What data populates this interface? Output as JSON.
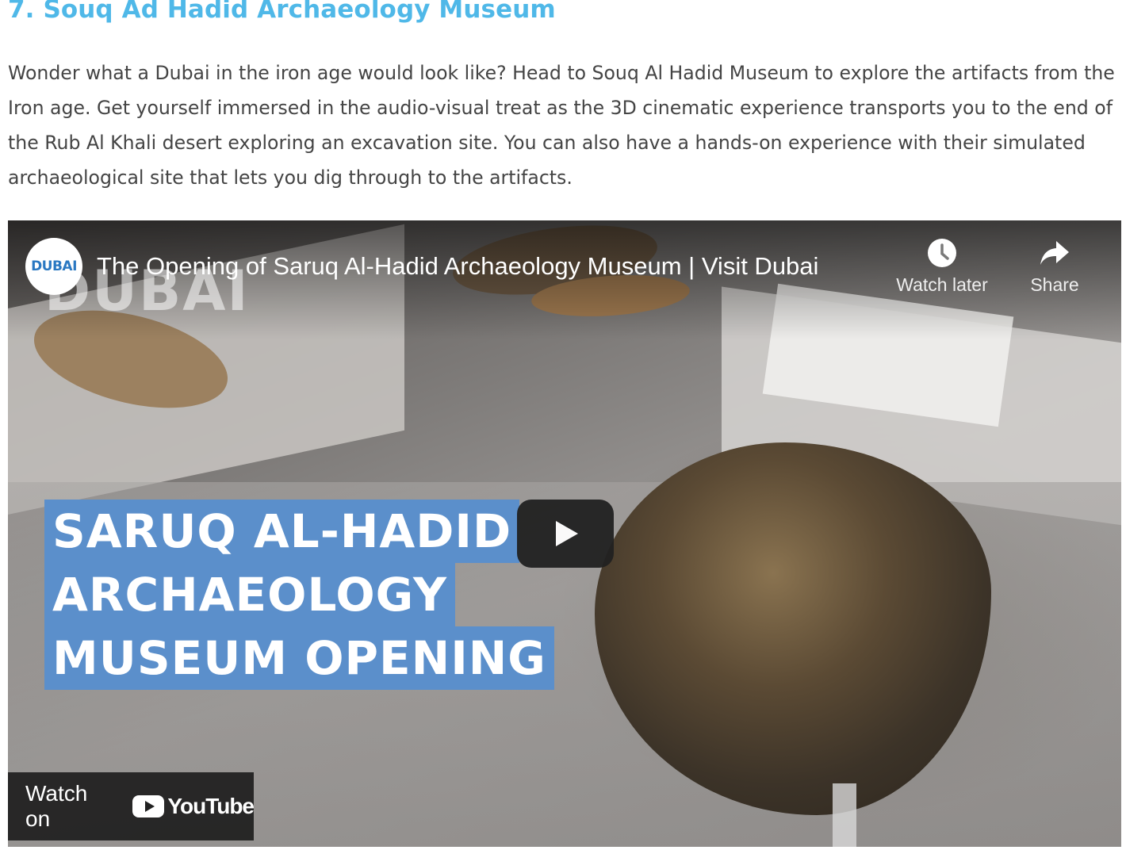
{
  "article": {
    "heading": "7. Souq Ad Hadid Archaeology Museum",
    "paragraph": "Wonder what a Dubai in the iron age would look like? Head to Souq Al Hadid Museum to explore the artifacts from the Iron age. Get yourself immersed in the audio-visual treat as the 3D cinematic experience transports you to the end of the Rub Al Khali desert exploring an excavation site. You can also have a hands-on experience with their simulated archaeological site that lets you dig through to the artifacts."
  },
  "video": {
    "channel_logo_text": "DUBAI",
    "title": "The Opening of Saruq Al-Hadid Archaeology Museum | Visit Dubai",
    "watch_later_label": "Watch later",
    "share_label": "Share",
    "overlay_lines": [
      "SARUQ AL-HADID",
      "ARCHAEOLOGY",
      "MUSEUM OPENING"
    ],
    "watch_on_label": "Watch on",
    "youtube_label": "YouTube",
    "overlay_color": "#5b8fcb"
  },
  "icons": {
    "play": "play-icon",
    "clock": "clock-icon",
    "share": "share-icon",
    "youtube": "youtube-logo-icon"
  }
}
